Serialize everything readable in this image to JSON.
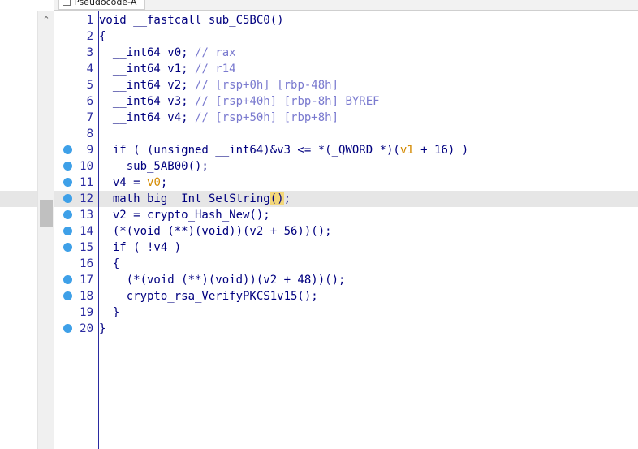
{
  "tab": {
    "title": "Pseudocode-A"
  },
  "colors": {
    "code_text": "#00007f",
    "comment": "#7a7acf",
    "variable_highlight": "#d48a00",
    "line_number": "#2a2aa0",
    "breakpoint": "#3ea0e8"
  },
  "current_line": 12,
  "lines": [
    {
      "n": "1",
      "bp": false,
      "segs": [
        {
          "t": "void __fastcall sub_C5BC0()"
        }
      ]
    },
    {
      "n": "2",
      "bp": false,
      "segs": [
        {
          "t": "{"
        }
      ]
    },
    {
      "n": "3",
      "bp": false,
      "segs": [
        {
          "t": "  __int64 v0; "
        },
        {
          "t": "// rax",
          "c": "cm"
        }
      ]
    },
    {
      "n": "4",
      "bp": false,
      "segs": [
        {
          "t": "  __int64 v1; "
        },
        {
          "t": "// r14",
          "c": "cm"
        }
      ]
    },
    {
      "n": "5",
      "bp": false,
      "segs": [
        {
          "t": "  __int64 v2; "
        },
        {
          "t": "// [rsp+0h] [rbp-48h]",
          "c": "cm"
        }
      ]
    },
    {
      "n": "6",
      "bp": false,
      "segs": [
        {
          "t": "  __int64 v3; "
        },
        {
          "t": "// [rsp+40h] [rbp-8h] BYREF",
          "c": "cm"
        }
      ]
    },
    {
      "n": "7",
      "bp": false,
      "segs": [
        {
          "t": "  __int64 v4; "
        },
        {
          "t": "// [rsp+50h] [rbp+8h]",
          "c": "cm"
        }
      ]
    },
    {
      "n": "8",
      "bp": false,
      "segs": [
        {
          "t": ""
        }
      ]
    },
    {
      "n": "9",
      "bp": true,
      "segs": [
        {
          "t": "  if ( (unsigned __int64)&v3 <= *(_QWORD *)("
        },
        {
          "t": "v1",
          "c": "var"
        },
        {
          "t": " + 16) )"
        }
      ]
    },
    {
      "n": "10",
      "bp": true,
      "segs": [
        {
          "t": "    sub_5AB00();"
        }
      ]
    },
    {
      "n": "11",
      "bp": true,
      "segs": [
        {
          "t": "  v4 = "
        },
        {
          "t": "v0",
          "c": "var"
        },
        {
          "t": ";"
        }
      ]
    },
    {
      "n": "12",
      "bp": true,
      "segs": [
        {
          "t": "  math_big__Int_SetString"
        },
        {
          "t": "()",
          "c": "hl-paren"
        },
        {
          "t": ";"
        }
      ]
    },
    {
      "n": "13",
      "bp": true,
      "segs": [
        {
          "t": "  v2 = crypto_Hash_New();"
        }
      ]
    },
    {
      "n": "14",
      "bp": true,
      "segs": [
        {
          "t": "  (*(void (**)(void))(v2 + 56))();"
        }
      ]
    },
    {
      "n": "15",
      "bp": true,
      "segs": [
        {
          "t": "  if ( !v4 )"
        }
      ]
    },
    {
      "n": "16",
      "bp": false,
      "segs": [
        {
          "t": "  {"
        }
      ]
    },
    {
      "n": "17",
      "bp": true,
      "segs": [
        {
          "t": "    (*(void (**)(void))(v2 + 48))();"
        }
      ]
    },
    {
      "n": "18",
      "bp": true,
      "segs": [
        {
          "t": "    crypto_rsa_VerifyPKCS1v15();"
        }
      ]
    },
    {
      "n": "19",
      "bp": false,
      "segs": [
        {
          "t": "  }"
        }
      ]
    },
    {
      "n": "20",
      "bp": true,
      "segs": [
        {
          "t": "}"
        }
      ]
    }
  ]
}
